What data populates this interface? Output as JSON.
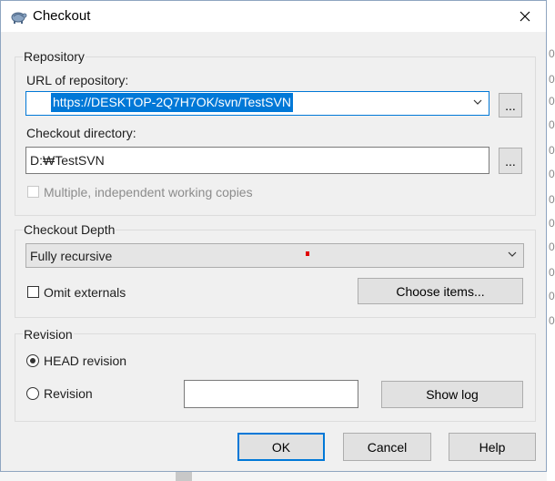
{
  "window": {
    "title": "Checkout"
  },
  "repository": {
    "group_label": "Repository",
    "url_label": "URL of repository:",
    "url_value": "https://DESKTOP-2Q7H7OK/svn/TestSVN",
    "browse_label": "...",
    "dir_label": "Checkout directory:",
    "dir_value": "D:\\TestSVN",
    "dir_display": "D:₩TestSVN",
    "multiple_label": "Multiple, independent working copies"
  },
  "depth": {
    "group_label": "Checkout Depth",
    "selected": "Fully recursive",
    "omit_label": "Omit externals",
    "choose_label": "Choose items..."
  },
  "revision": {
    "group_label": "Revision",
    "head_label": "HEAD revision",
    "revision_label": "Revision",
    "revision_value": "",
    "show_log_label": "Show log"
  },
  "buttons": {
    "ok": "OK",
    "cancel": "Cancel",
    "help": "Help"
  },
  "background": {
    "chars": [
      "0",
      "0",
      "0",
      "0",
      "0",
      "0",
      "0",
      "0",
      "0",
      "0",
      "0",
      "0"
    ]
  },
  "colors": {
    "accent": "#0078d7"
  }
}
